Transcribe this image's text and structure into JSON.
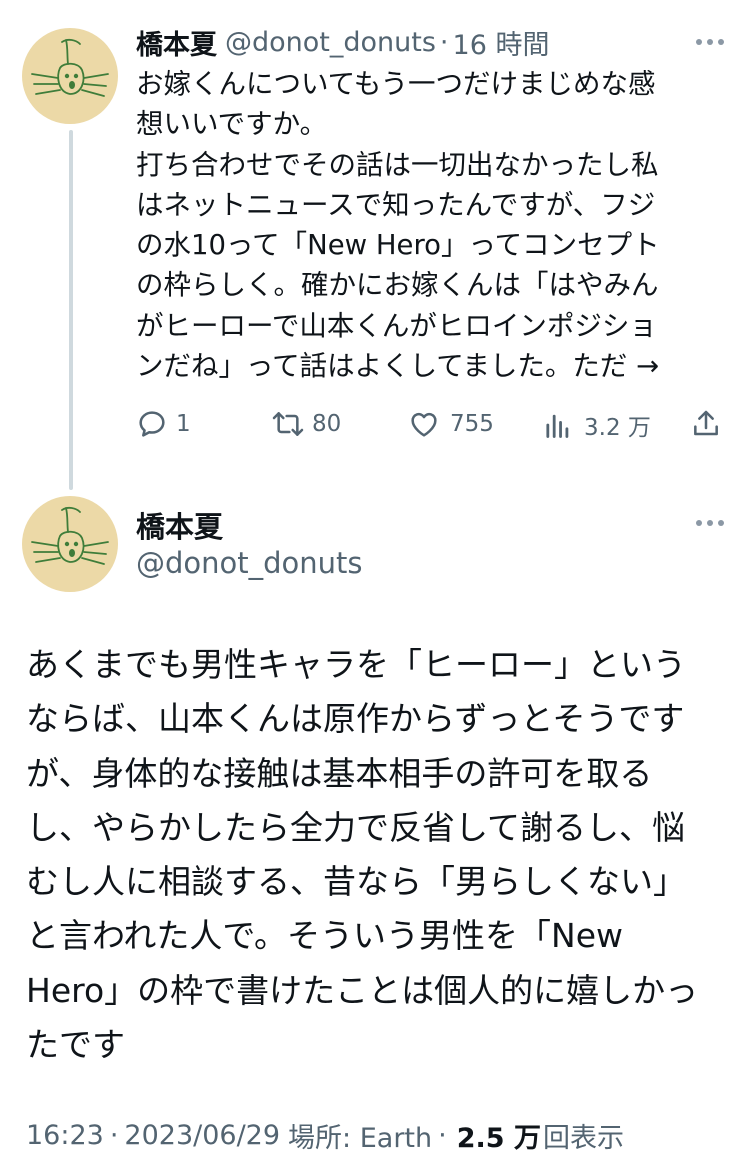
{
  "tweet1": {
    "display_name": "橋本夏",
    "handle": "@donot_donuts",
    "separator": "·",
    "time_ago": "16 時間",
    "text_lines": [
      "お嫁くんについてもう一つだけまじめな感",
      "想いいですか。",
      "打ち合わせでその話は一切出なかったし私",
      "はネットニュースで知ったんですが、フジ",
      "の水10って「New Hero」ってコンセプト",
      "の枠らしく。確かにお嫁くんは「はやみん",
      "がヒーローで山本くんがヒロインポジショ",
      "ンだね」って話はよくしてました。ただ →"
    ],
    "replies": "1",
    "retweets": "80",
    "likes": "755",
    "views": "3.2 万"
  },
  "tweet2": {
    "display_name": "橋本夏",
    "handle": "@donot_donuts",
    "text_lines": [
      "あくまでも男性キャラを「ヒーロー」という",
      "ならば、山本くんは原作からずっとそうです",
      "が、身体的な接触は基本相手の許可を取る",
      "し、やらかしたら全力で反省して謝るし、悩",
      "むし人に相談する、昔なら「男らしくない」",
      "と言われた人で。そういう男性を「New",
      "Hero」の枠で書けたことは個人的に嬉しかっ",
      "たです"
    ],
    "time": "16:23",
    "separator": "·",
    "date": "2023/06/29",
    "location": "場所: Earth",
    "views_count": "2.5 万",
    "views_label": "回表示"
  },
  "icons": {
    "more": "more-horizontal-icon",
    "reply": "reply-icon",
    "retweet": "retweet-icon",
    "like": "heart-icon",
    "views": "analytics-icon",
    "share": "share-icon"
  },
  "colors": {
    "text": "#0f1419",
    "secondary": "#536471",
    "avatar_bg": "#ecd9a7",
    "thread_line": "#cfd9de"
  }
}
